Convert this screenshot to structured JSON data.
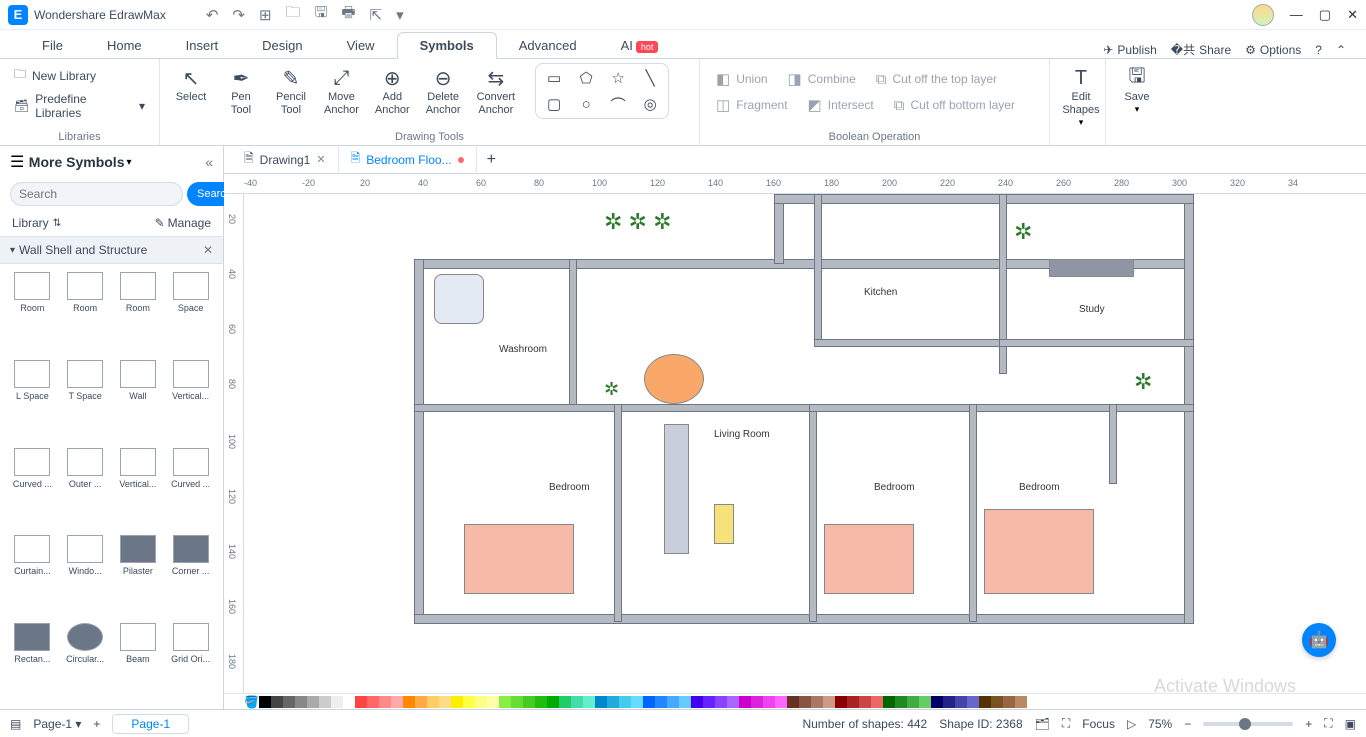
{
  "app": {
    "title": "Wondershare EdrawMax"
  },
  "qat_icons": [
    "undo",
    "redo",
    "new",
    "open",
    "save",
    "print",
    "export",
    "more"
  ],
  "menu": {
    "items": [
      "File",
      "Home",
      "Insert",
      "Design",
      "View",
      "Symbols",
      "Advanced",
      "AI"
    ],
    "active": "Symbols",
    "ai_badge": "hot",
    "publish": "Publish",
    "share": "Share",
    "options": "Options"
  },
  "ribbon": {
    "libraries": {
      "new": "New Library",
      "predefine": "Predefine Libraries",
      "label": "Libraries"
    },
    "drawing": {
      "select": "Select",
      "pen": "Pen\nTool",
      "pencil": "Pencil\nTool",
      "move": "Move\nAnchor",
      "add": "Add\nAnchor",
      "delete": "Delete\nAnchor",
      "convert": "Convert\nAnchor",
      "label": "Drawing Tools"
    },
    "boolean": {
      "union": "Union",
      "combine": "Combine",
      "cutTop": "Cut off the top layer",
      "fragment": "Fragment",
      "intersect": "Intersect",
      "cutBottom": "Cut off bottom layer",
      "label": "Boolean Operation"
    },
    "edit": {
      "shapes": "Edit\nShapes"
    },
    "save": "Save"
  },
  "leftPanel": {
    "title": "More Symbols",
    "search_placeholder": "Search",
    "search_btn": "Search",
    "library": "Library",
    "manage": "Manage",
    "category": "Wall Shell and Structure",
    "shapes": [
      "Room",
      "Room",
      "Room",
      "Space",
      "L Space",
      "T Space",
      "Wall",
      "Vertical...",
      "Curved ...",
      "Outer ...",
      "Vertical...",
      "Curved ...",
      "Curtain...",
      "Windo...",
      "Pilaster",
      "Corner ...",
      "Rectan...",
      "Circular...",
      "Beam",
      "Grid Ori..."
    ]
  },
  "tabs": {
    "t1": "Drawing1",
    "t2": "Bedroom Floo..."
  },
  "ruler": {
    "h": [
      "-40",
      "-20",
      "20",
      "40",
      "60",
      "80",
      "100",
      "120",
      "140",
      "160",
      "180",
      "200",
      "220",
      "240",
      "260",
      "280",
      "300",
      "320",
      "34"
    ],
    "v": [
      "20",
      "40",
      "60",
      "80",
      "100",
      "120",
      "140",
      "160",
      "180"
    ]
  },
  "rooms": {
    "washroom": "Washroom",
    "living": "Living Room",
    "kitchen": "Kitchen",
    "study": "Study",
    "bed1": "Bedroom",
    "bed2": "Bedroom",
    "bed3": "Bedroom"
  },
  "status": {
    "page_sel": "Page-1",
    "page_tab": "Page-1",
    "shapes_count": "Number of shapes: 442",
    "shape_id": "Shape ID: 2368",
    "focus": "Focus",
    "zoom": "75%"
  },
  "watermark": "Activate Windows",
  "palette": [
    "#000",
    "#444",
    "#666",
    "#888",
    "#aaa",
    "#ccc",
    "#eee",
    "#fff",
    "#f44",
    "#f66",
    "#f88",
    "#faa",
    "#f80",
    "#fa4",
    "#fc6",
    "#fd8",
    "#fe0",
    "#ff4",
    "#ff8",
    "#ffa",
    "#8e4",
    "#6d3",
    "#4c2",
    "#2b1",
    "#0a0",
    "#2c6",
    "#4da",
    "#6ec",
    "#08c",
    "#2ad",
    "#4ce",
    "#6df",
    "#06f",
    "#28f",
    "#4af",
    "#6cf",
    "#40e",
    "#62f",
    "#84f",
    "#a6f",
    "#c0c",
    "#d2d",
    "#e4e",
    "#f6f",
    "#632",
    "#854",
    "#a76",
    "#c98",
    "#800",
    "#a22",
    "#c44",
    "#e66",
    "#060",
    "#282",
    "#4a4",
    "#6c6",
    "#006",
    "#228",
    "#44a",
    "#66c",
    "#530",
    "#752",
    "#964",
    "#b86"
  ]
}
